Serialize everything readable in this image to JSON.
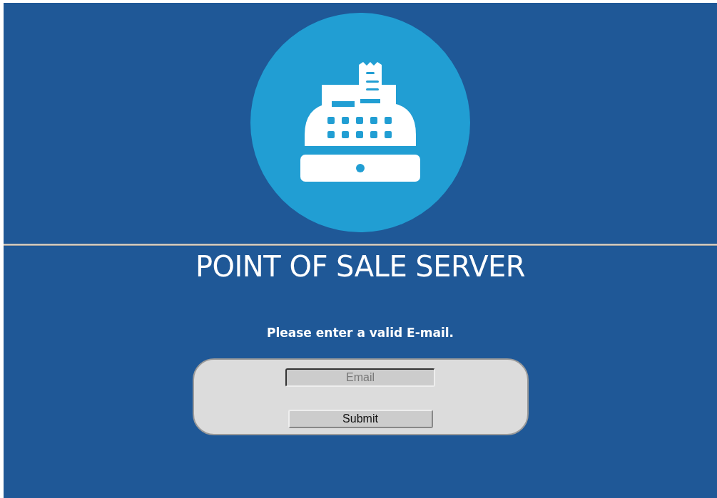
{
  "title": "POINT OF SALE SERVER",
  "message": "Please enter a valid E-mail.",
  "form": {
    "email": {
      "placeholder": "Email"
    },
    "submit": "Submit"
  }
}
